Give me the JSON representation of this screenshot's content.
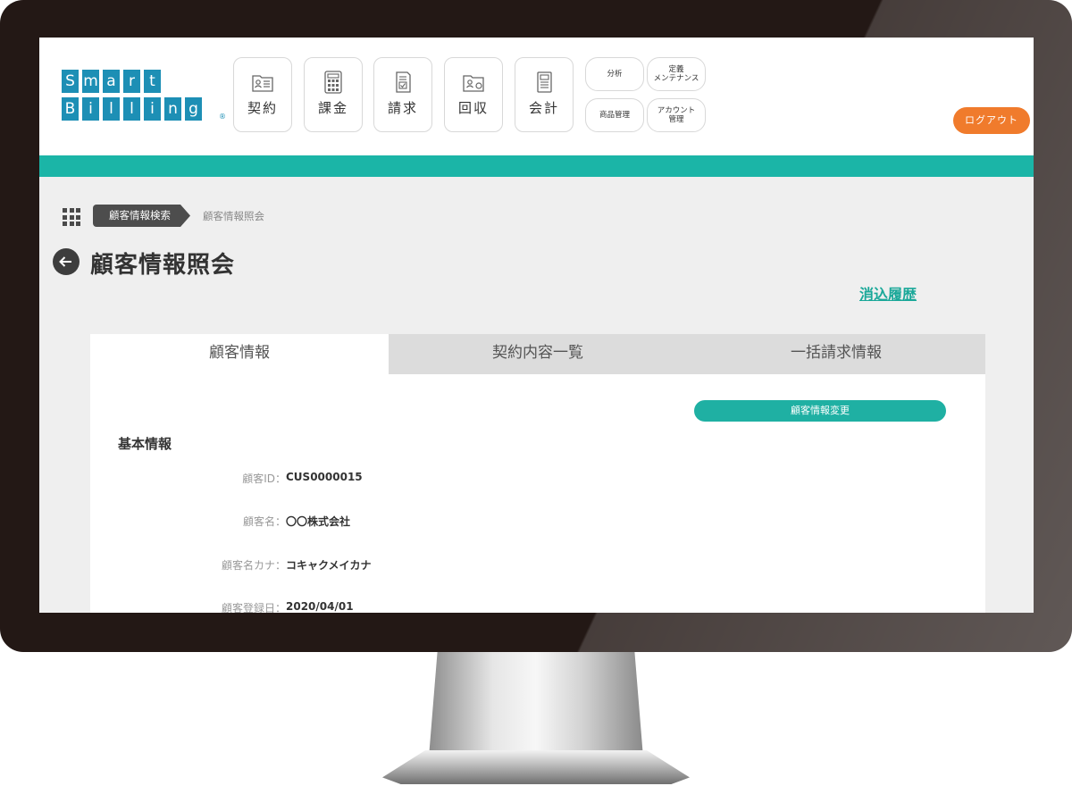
{
  "logo": {
    "row1": [
      "S",
      "m",
      "a",
      "r",
      "t"
    ],
    "row2": [
      "B",
      "i",
      "l",
      "l",
      "i",
      "n",
      "g"
    ],
    "mark": "®"
  },
  "nav": {
    "main": [
      {
        "label": "契約",
        "icon": "contract-icon"
      },
      {
        "label": "課金",
        "icon": "calculator-icon"
      },
      {
        "label": "請求",
        "icon": "invoice-icon"
      },
      {
        "label": "回収",
        "icon": "collection-icon"
      },
      {
        "label": "会計",
        "icon": "accounting-icon"
      }
    ],
    "small": [
      {
        "label": "分析"
      },
      {
        "label": "定義\nメンテナンス"
      },
      {
        "label": "商品管理"
      },
      {
        "label": "アカウント\n管理"
      }
    ]
  },
  "logout": "ログアウト",
  "breadcrumb": {
    "parent": "顧客情報検索",
    "current": "顧客情報照会"
  },
  "page": {
    "title": "顧客情報照会",
    "history_link": "消込履歴"
  },
  "tabs": [
    "顧客情報",
    "契約内容一覧",
    "一括請求情報"
  ],
  "panel": {
    "edit_button": "顧客情報変更",
    "section_title": "基本情報",
    "fields": [
      {
        "label": "顧客ID：",
        "value": "CUS0000015"
      },
      {
        "label": "顧客名：",
        "value": "〇〇株式会社"
      },
      {
        "label": "顧客名カナ：",
        "value": "コキャクメイカナ"
      },
      {
        "label": "顧客登録日：",
        "value": "2020/04/01"
      }
    ]
  },
  "colors": {
    "teal": "#1bb5a7",
    "orange": "#f07b2c",
    "logo_blue": "#1d8fb5",
    "bezel": "#231815"
  }
}
